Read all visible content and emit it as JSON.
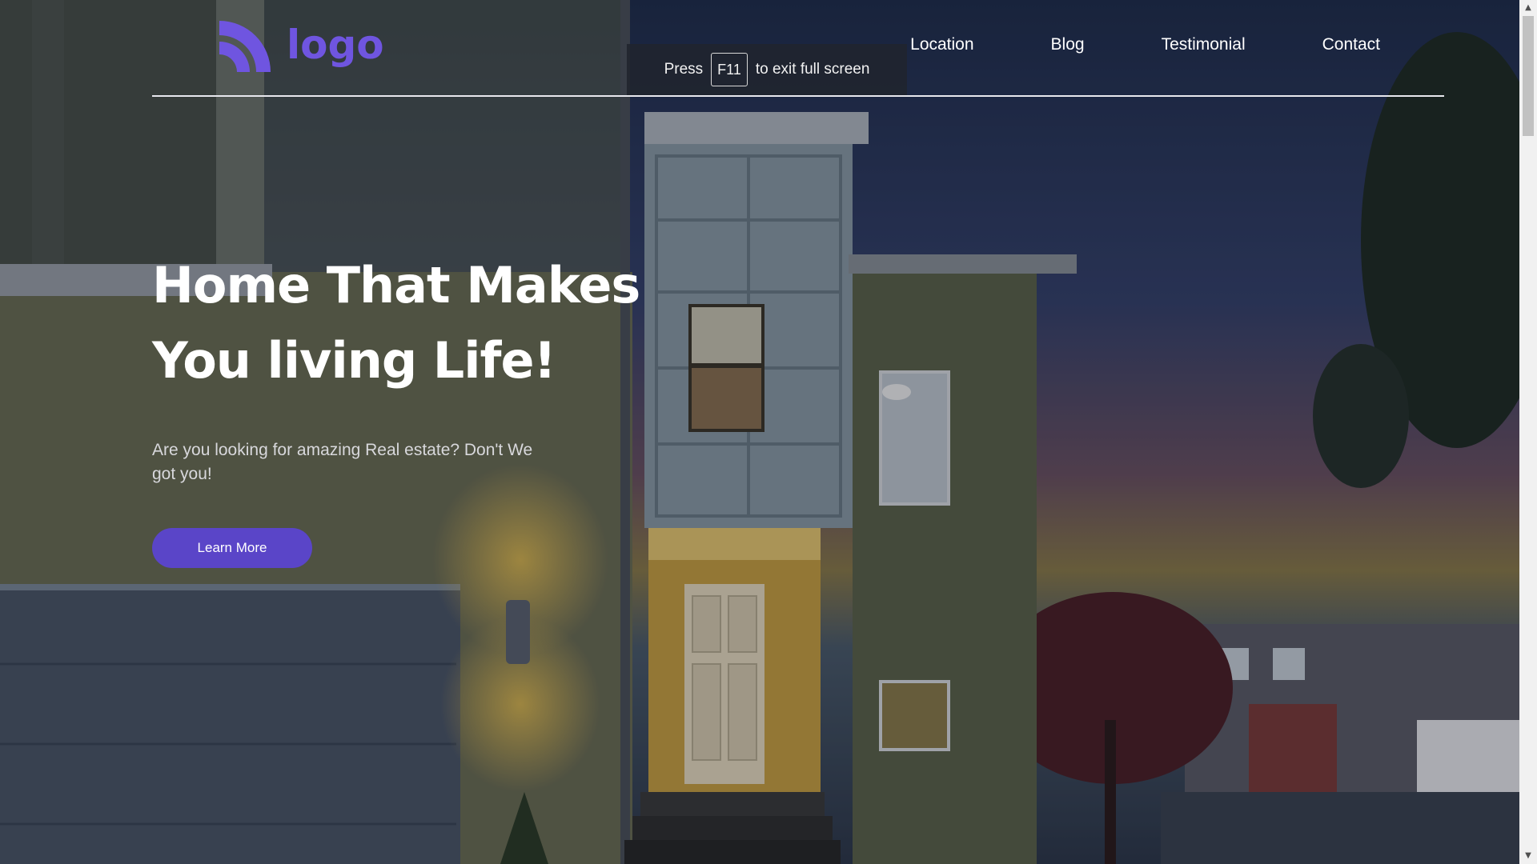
{
  "logo": {
    "text": "logo",
    "icon": "rainbow-arc-icon",
    "color": "#6f55e0"
  },
  "nav": {
    "items": [
      {
        "label": "Location"
      },
      {
        "label": "Blog"
      },
      {
        "label": "Testimonial"
      },
      {
        "label": "Contact"
      }
    ]
  },
  "fullscreen_toast": {
    "prefix": "Press",
    "key": "F11",
    "suffix": "to exit full screen"
  },
  "hero": {
    "title_line1": "Home That Makes",
    "title_line2": "You living Life!",
    "subtitle": "Are you looking for amazing Real estate? Don't We got you!",
    "cta_label": "Learn More",
    "cta_color": "#5a45c8"
  },
  "scrollbar": {
    "up_icon": "scroll-up-arrow-icon",
    "down_icon": "scroll-down-arrow-icon"
  }
}
